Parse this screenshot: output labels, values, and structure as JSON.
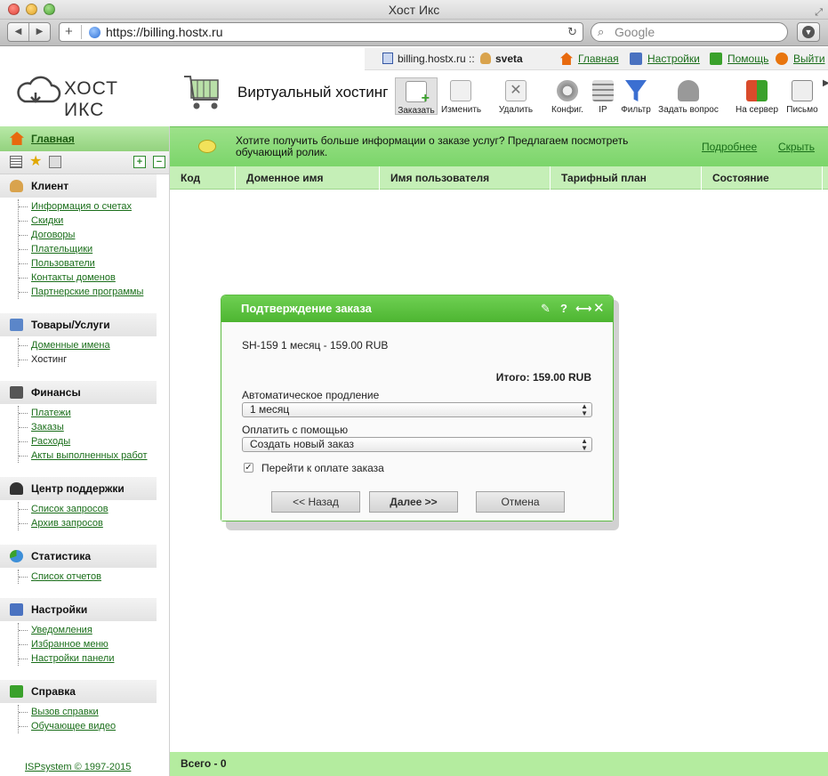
{
  "window": {
    "title": "Хост Икс"
  },
  "browser": {
    "url": "https://billing.hostx.ru",
    "search_placeholder": "Google"
  },
  "userbar": {
    "server": "billing.hostx.ru ::",
    "user": "sveta",
    "links": [
      {
        "label": "Главная",
        "icon": "home-icon"
      },
      {
        "label": "Настройки",
        "icon": "settings-icon"
      },
      {
        "label": "Помощь",
        "icon": "help-icon"
      },
      {
        "label": "Выйти",
        "icon": "logout-icon"
      }
    ]
  },
  "logo": {
    "text": "ХОСТ ИКС"
  },
  "page": {
    "title": "Виртуальный хостинг"
  },
  "toolbar": {
    "items": [
      {
        "label": "Заказать",
        "icon": "order-icon",
        "color": "#3aa12b"
      },
      {
        "label": "Изменить",
        "icon": "edit-icon",
        "color": "#8a8a8a"
      },
      {
        "label": "Удалить",
        "icon": "delete-icon",
        "color": "#9a9a9a"
      },
      {
        "label": "Конфиг.",
        "icon": "config-icon",
        "color": "#7a7a7a"
      },
      {
        "label": "IP",
        "icon": "ip-icon",
        "color": "#8a8a8a"
      },
      {
        "label": "Фильтр",
        "icon": "filter-icon",
        "color": "#3b6fd1"
      },
      {
        "label": "Задать вопрос",
        "icon": "ask-icon",
        "color": "#7a7a7a"
      },
      {
        "label": "На сервер",
        "icon": "to-server-icon",
        "color": "#d94b2b"
      },
      {
        "label": "Письмо",
        "icon": "mail-icon",
        "color": "#8a8a8a"
      }
    ]
  },
  "sidebar": {
    "home": "Главная",
    "groups": [
      {
        "title": "Клиент",
        "icon": "client-icon",
        "color": "#d9a34d",
        "items": [
          "Информация о счетах",
          "Скидки",
          "Договоры",
          "Плательщики",
          "Пользователи",
          "Контакты доменов",
          "Партнерские программы"
        ]
      },
      {
        "title": "Товары/Услуги",
        "icon": "cart-icon",
        "color": "#5b86c9",
        "items": [
          "Доменные имена",
          "Хостинг"
        ]
      },
      {
        "title": "Финансы",
        "icon": "finance-icon",
        "color": "#555555",
        "items": [
          "Платежи",
          "Заказы",
          "Расходы",
          "Акты выполненных работ"
        ]
      },
      {
        "title": "Центр поддержки",
        "icon": "headset-icon",
        "color": "#333333",
        "items": [
          "Список запросов",
          "Архив запросов"
        ]
      },
      {
        "title": "Статистика",
        "icon": "stats-icon",
        "color": "#3d8fd8",
        "items": [
          "Список отчетов"
        ]
      },
      {
        "title": "Настройки",
        "icon": "settings-icon",
        "color": "#4a72c0",
        "items": [
          "Уведомления",
          "Избранное меню",
          "Настройки панели"
        ]
      },
      {
        "title": "Справка",
        "icon": "help-icon",
        "color": "#3aa12b",
        "items": [
          "Вызов справки",
          "Обучающее видео"
        ]
      }
    ],
    "footer": "ISPsystem © 1997-2015"
  },
  "banner": {
    "message": "Хотите получить больше информации о заказе услуг? Предлагаем посмотреть обучающий ролик.",
    "more": "Подробнее",
    "hide": "Скрыть"
  },
  "table": {
    "columns": [
      "Код",
      "Доменное имя",
      "Имя пользователя",
      "Тарифный план",
      "Состояние"
    ],
    "footer": "Всего - 0"
  },
  "dialog": {
    "title": "Подтверждение заказа",
    "line": "SH-159 1 месяц - 159.00 RUB",
    "total": "Итого: 159.00 RUB",
    "renew_label": "Автоматическое продление",
    "renew_value": "1 месяц",
    "pay_label": "Оплатить с помощью",
    "pay_value": "Создать новый заказ",
    "goto_pay_label": "Перейти к оплате заказа",
    "goto_pay_checked": true,
    "buttons": {
      "back": "<< Назад",
      "next": "Далее >>",
      "cancel": "Отмена"
    }
  },
  "colors": {
    "accent_green": "#4db531",
    "banner_green": "#9de18a",
    "link_green": "#1a6e1a"
  }
}
